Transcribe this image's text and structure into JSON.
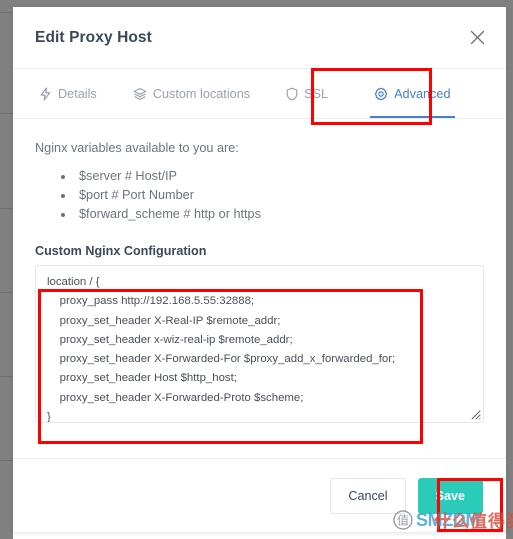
{
  "window": {
    "title": "Edit Proxy Host",
    "close_icon": "close-x-icon"
  },
  "tabs": [
    {
      "id": "details",
      "label": "Details",
      "icon": "bolt-icon",
      "active": false
    },
    {
      "id": "custom-locations",
      "label": "Custom locations",
      "icon": "layers-icon",
      "active": false
    },
    {
      "id": "ssl",
      "label": "SSL",
      "icon": "shield-icon",
      "active": false
    },
    {
      "id": "advanced",
      "label": "Advanced",
      "icon": "gear-icon",
      "active": true
    }
  ],
  "body": {
    "intro": "Nginx variables available to you are:",
    "variables": [
      "$server # Host/IP",
      "$port # Port Number",
      "$forward_scheme # http or https"
    ],
    "config_label": "Custom Nginx Configuration",
    "config_value": "location / {\n    proxy_pass http://192.168.5.55:32888;\n    proxy_set_header X-Real-IP $remote_addr;\n    proxy_set_header x-wiz-real-ip $remote_addr;\n    proxy_set_header X-Forwarded-For $proxy_add_x_forwarded_for;\n    proxy_set_header Host $http_host;\n    proxy_set_header X-Forwarded-Proto $scheme;\n}",
    "config_placeholder": ""
  },
  "footer": {
    "cancel_label": "Cancel",
    "save_label": "Save"
  },
  "watermark": {
    "text_latin": "SMZDM",
    "text_cn": "什么值得买",
    "badge_cn": "值"
  },
  "colors": {
    "accent_blue": "#467fcf",
    "save_teal": "#2bcbba",
    "annotation_red": "#ff0000",
    "muted_text": "#6c757d",
    "title_text": "#3c4858",
    "border": "#e3e6ea",
    "backdrop_grey": "#808080"
  }
}
